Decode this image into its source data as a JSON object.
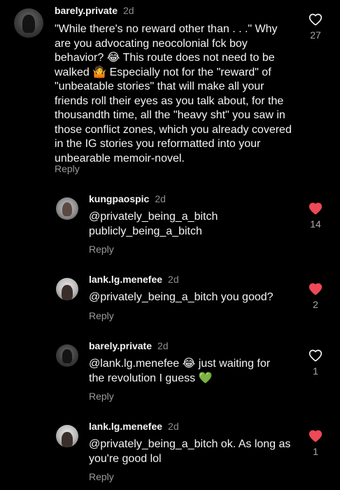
{
  "comments": [
    {
      "username": "barely.private",
      "time": "2d",
      "text": "\"While there's no reward other than . . .\" Why are you advocating neocolonial fck boy behavior? 😂 This route does not need to be walked 🤷 Especially not for the \"reward\" of \"unbeatable stories\" that will make all your friends roll their eyes as you talk about, for the thousandth time, all the \"heavy sht\" you saw in those conflict zones, which you already covered in the IG stories you reformatted into your unbearable memoir-novel.",
      "reply": "Reply",
      "likes": "27",
      "liked": false
    },
    {
      "username": "kungpaospic",
      "time": "2d",
      "text": "@privately_being_a_bitch publicly_being_a_bitch",
      "reply": "Reply",
      "likes": "14",
      "liked": true
    },
    {
      "username": "lank.lg.menefee",
      "time": "2d",
      "text": "@privately_being_a_bitch  you good?",
      "reply": "Reply",
      "likes": "2",
      "liked": true
    },
    {
      "username": "barely.private",
      "time": "2d",
      "text": "@lank.lg.menefee 😂 just waiting for the revolution I guess 💚",
      "reply": "Reply",
      "likes": "1",
      "liked": false
    },
    {
      "username": "lank.lg.menefee",
      "time": "2d",
      "text": "@privately_being_a_bitch ok. As long as you're good lol",
      "reply": "Reply",
      "likes": "1",
      "liked": true
    }
  ],
  "colors": {
    "background": "#000000",
    "like_red": "#ed4956",
    "secondary_text": "#8e8e8e"
  },
  "icons": {
    "like": "heart-icon"
  }
}
